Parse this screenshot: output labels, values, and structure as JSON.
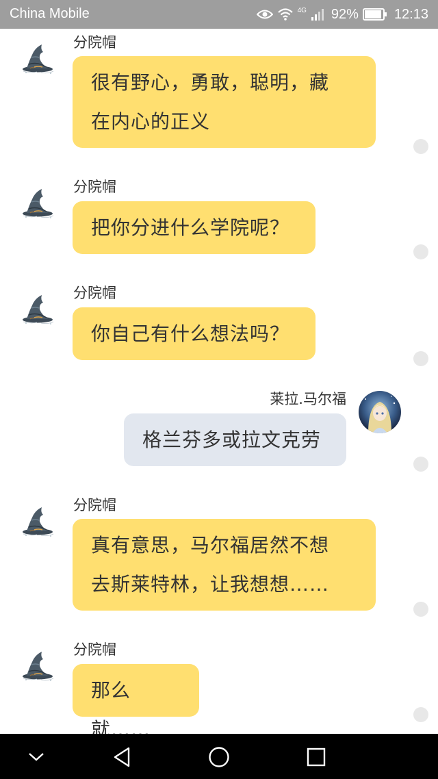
{
  "status_bar": {
    "carrier": "China Mobile",
    "network": "4G",
    "battery_percent": "92%",
    "time": "12:13",
    "icons": [
      "eye-icon",
      "wifi-icon",
      "signal-icon",
      "battery-icon"
    ],
    "battery_level": 0.92
  },
  "messages": [
    {
      "sender": "分院帽",
      "direction": "incoming",
      "avatar": "sorting-hat-avatar",
      "lines": [
        "很有野心，勇敢，聪明，藏",
        "在内心的正义"
      ]
    },
    {
      "sender": "分院帽",
      "direction": "incoming",
      "avatar": "sorting-hat-avatar",
      "lines": [
        "把你分进什么学院呢？"
      ]
    },
    {
      "sender": "分院帽",
      "direction": "incoming",
      "avatar": "sorting-hat-avatar",
      "lines": [
        "你自己有什么想法吗？"
      ]
    },
    {
      "sender": "莱拉.马尔福",
      "direction": "outgoing",
      "avatar": "girl-avatar",
      "lines": [
        "格兰芬多或拉文克劳"
      ]
    },
    {
      "sender": "分院帽",
      "direction": "incoming",
      "avatar": "sorting-hat-avatar",
      "lines": [
        "真有意思，马尔福居然不想",
        "去斯莱特林，让我想想……"
      ]
    },
    {
      "sender": "分院帽",
      "direction": "incoming",
      "avatar": "sorting-hat-avatar",
      "lines": [
        "那么就……"
      ]
    }
  ],
  "nav_bar": {
    "buttons": [
      "collapse-icon",
      "back-icon",
      "home-icon",
      "recents-icon"
    ]
  },
  "colors": {
    "incoming_bubble": "#ffdf70",
    "outgoing_bubble": "#e2e7ef",
    "status_bar": "#9e9e9e",
    "nav_bar": "#000000"
  }
}
